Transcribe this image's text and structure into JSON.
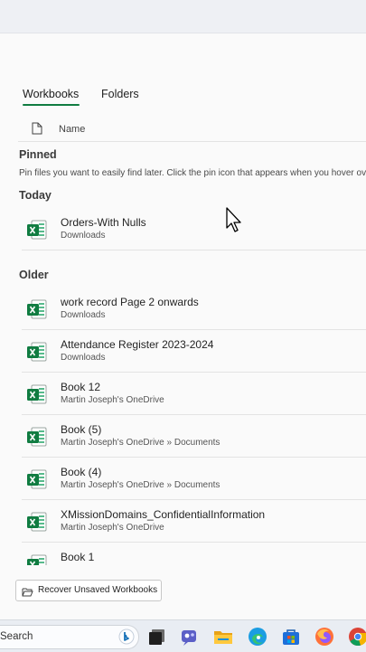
{
  "tabs": [
    {
      "label": "Workbooks",
      "active": true
    },
    {
      "label": "Folders",
      "active": false
    }
  ],
  "list_header": {
    "name_label": "Name"
  },
  "pinned": {
    "title": "Pinned",
    "description": "Pin files you want to easily find later. Click the pin icon that appears when you hover over a file."
  },
  "sections": {
    "today": "Today",
    "older": "Older"
  },
  "today_files": [
    {
      "name": "Orders-With Nulls",
      "location": "Downloads"
    }
  ],
  "older_files": [
    {
      "name": "work record Page 2 onwards",
      "location": "Downloads"
    },
    {
      "name": "Attendance Register 2023-2024",
      "location": "Downloads"
    },
    {
      "name": "Book 12",
      "location": "Martin Joseph's OneDrive"
    },
    {
      "name": "Book (5)",
      "location": "Martin Joseph's OneDrive » Documents"
    },
    {
      "name": "Book (4)",
      "location": "Martin Joseph's OneDrive » Documents"
    },
    {
      "name": "XMissionDomains_ConfidentialInformation",
      "location": "Martin Joseph's OneDrive"
    },
    {
      "name": "Book 1",
      "location": ""
    }
  ],
  "recover_button": {
    "label": "Recover Unsaved Workbooks"
  },
  "taskbar": {
    "search_label": "Search",
    "icons": [
      "bing-icon",
      "task-view-icon",
      "teams-icon",
      "file-explorer-icon",
      "edge-icon",
      "store-icon",
      "firefox-icon",
      "chrome-icon"
    ]
  },
  "colors": {
    "excel_green": "#107c41",
    "accent_underline": "#107c41"
  }
}
